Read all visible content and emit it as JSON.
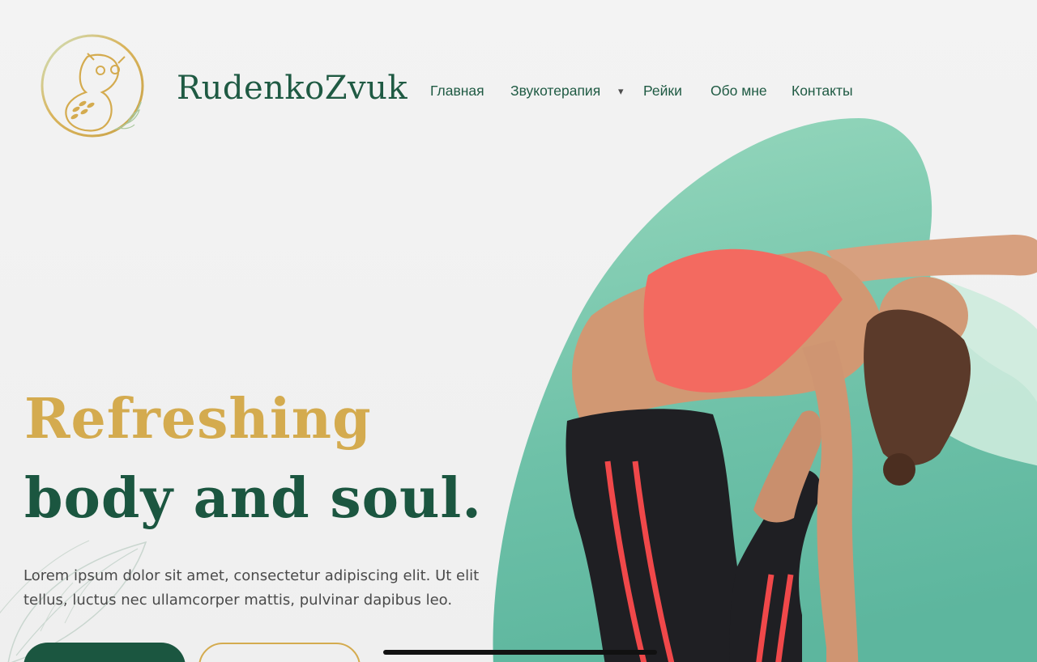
{
  "brand": {
    "name": "RudenkoZvuk",
    "logo_icon": "owl-in-circle-icon"
  },
  "nav": {
    "items": [
      {
        "label": "Главная"
      },
      {
        "label": "Звукотерапия"
      },
      {
        "label": "Рейки"
      },
      {
        "label": "Обо мне"
      },
      {
        "label": "Контакты"
      }
    ],
    "dropdown_indicator": "▾"
  },
  "hero": {
    "headline_line1": "Refreshing",
    "headline_line2": "body and soul.",
    "lead": "Lorem ipsum dolor sit amet, consectetur adipiscing elit. Ut elit tellus, luctus nec ullamcorper mattis, pulvinar dapibus leo."
  },
  "colors": {
    "brand_green": "#1b5640",
    "brand_gold": "#d4ab4f",
    "blob_mint": "#8fd6bb",
    "background": "#f1f1f1"
  }
}
